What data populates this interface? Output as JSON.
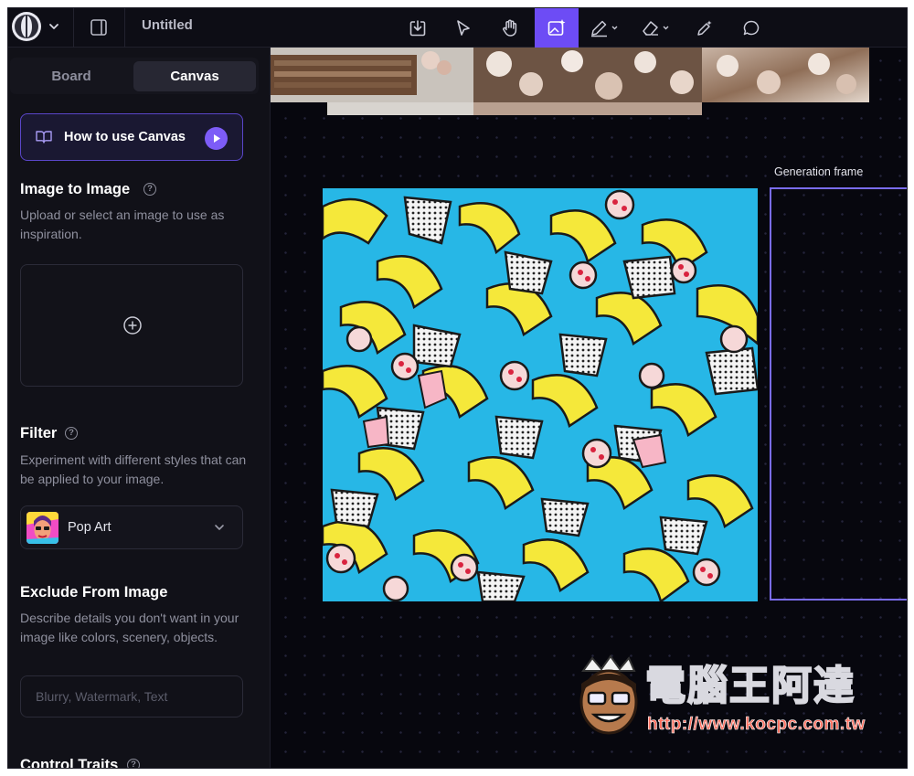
{
  "topbar": {
    "title": "Untitled",
    "tools": [
      "import-icon",
      "select-icon",
      "pan-icon",
      "generate-icon",
      "draw-icon",
      "erase-icon",
      "mask-icon",
      "comment-icon"
    ],
    "active_tool": "generate-icon",
    "accent": "#6d4cf5"
  },
  "sidebar": {
    "tabs": [
      {
        "label": "Board"
      },
      {
        "label": "Canvas"
      }
    ],
    "active_tab": "Canvas",
    "how_to": {
      "label": "How to use Canvas"
    },
    "image_to_image": {
      "title": "Image to Image",
      "description": "Upload or select an image to use as inspiration."
    },
    "filter": {
      "title": "Filter",
      "description": "Experiment with different styles that can be applied to your image.",
      "selected": "Pop Art"
    },
    "exclude": {
      "title": "Exclude From Image",
      "description": "Describe details you don't want in your image like colors, scenery, objects.",
      "placeholder": "Blurry, Watermark, Text"
    },
    "control_traits": {
      "title": "Control Traits"
    }
  },
  "canvas": {
    "generation_frame_label": "Generation frame"
  },
  "watermark": {
    "title": "電腦王阿達",
    "url": "http://www.kocpc.com.tw"
  }
}
